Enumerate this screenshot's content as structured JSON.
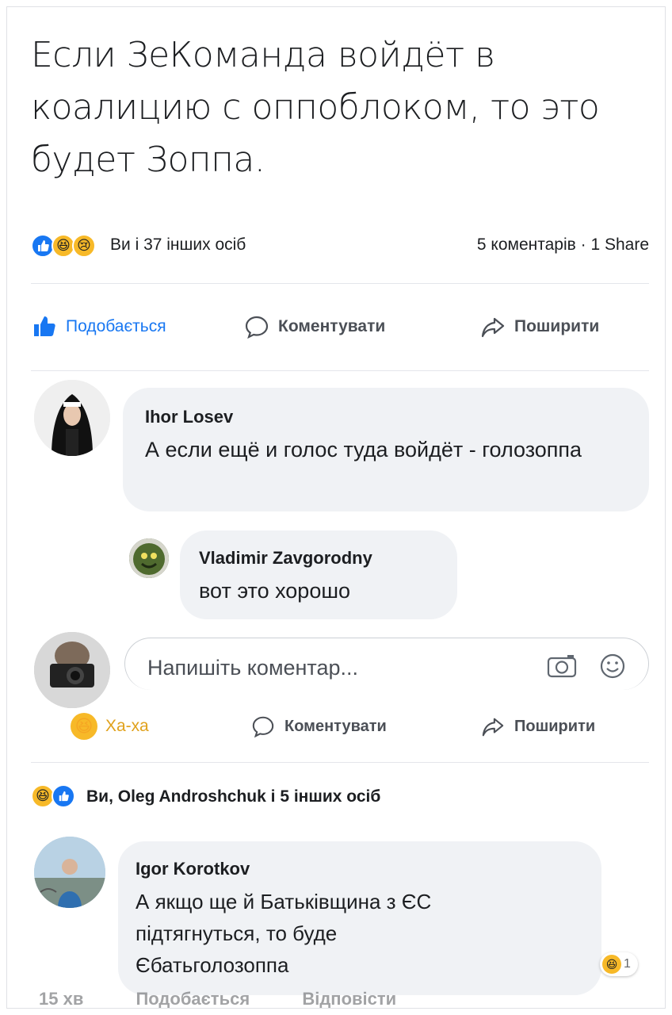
{
  "post": {
    "text": "Если ЗеКоманда войдёт в коалицию с оппоблоком, то это будет Зоппа."
  },
  "reactions": {
    "icons": [
      "like-icon",
      "haha-icon",
      "sad-icon"
    ],
    "summary": "Ви і 37 інших осіб",
    "meta": "5 коментарів · 1 Share"
  },
  "actions": {
    "like": "Подобається",
    "comment": "Коментувати",
    "share": "Поширити"
  },
  "comments": [
    {
      "author": "Ihor Losev",
      "text": "А если ещё и голос туда войдёт - голозоппа"
    },
    {
      "author": "Vladimir Zavgorodny",
      "text": "вот это хорошо"
    }
  ],
  "composer": {
    "placeholder": "Напишіть коментар..."
  },
  "post2_actions": {
    "reaction": "Ха-ха",
    "comment": "Коментувати",
    "share": "Поширити"
  },
  "post2_reactions": {
    "summary": "Ви, Oleg Androshchuk і 5 інших осіб"
  },
  "comment3": {
    "author": "Igor Korotkov",
    "text_line1": "А якщо ще й Батьківщина з ЄС",
    "text_line2": "підтягнуться, то буде",
    "text_line3": "Єбатьголозоппа",
    "reaction_count": "1"
  },
  "reply_footer": {
    "time": "15 хв",
    "like": "Подобається",
    "reply": "Відповісти"
  },
  "colors": {
    "accent": "#1877f2",
    "bubble": "#f0f2f5",
    "muted": "#65676b"
  }
}
